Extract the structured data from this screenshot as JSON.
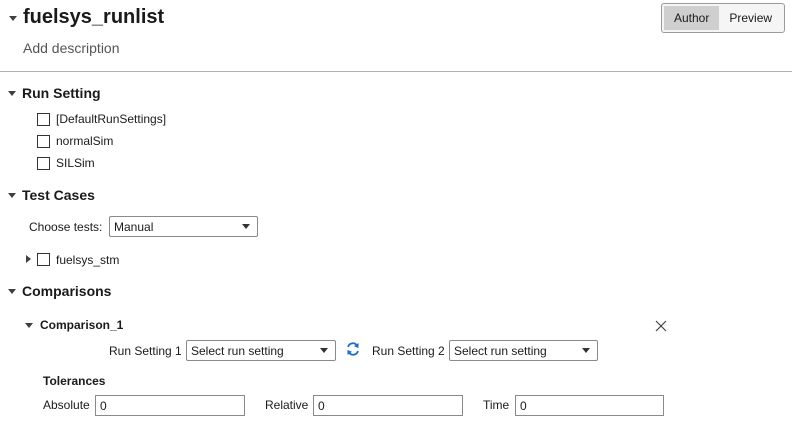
{
  "header": {
    "title": "fuelsys_runlist",
    "description_placeholder": "Add description",
    "modes": [
      {
        "label": "Author",
        "active": true
      },
      {
        "label": "Preview",
        "active": false
      }
    ]
  },
  "run_setting": {
    "title": "Run Setting",
    "items": [
      {
        "label": "[DefaultRunSettings]",
        "checked": false
      },
      {
        "label": "normalSim",
        "checked": false
      },
      {
        "label": "SILSim",
        "checked": false
      }
    ]
  },
  "test_cases": {
    "title": "Test Cases",
    "choose_label": "Choose tests:",
    "choose_value": "Manual",
    "items": [
      {
        "label": "fuelsys_stm",
        "checked": false,
        "expanded": false
      }
    ]
  },
  "comparisons": {
    "title": "Comparisons",
    "items": [
      {
        "name": "Comparison_1",
        "run_setting_1_label": "Run Setting 1",
        "run_setting_1_value": "Select run setting",
        "run_setting_2_label": "Run Setting 2",
        "run_setting_2_value": "Select run setting",
        "tolerances": {
          "title": "Tolerances",
          "absolute_label": "Absolute",
          "absolute_value": "0",
          "relative_label": "Relative",
          "relative_value": "0",
          "time_label": "Time",
          "time_value": "0"
        }
      }
    ]
  },
  "colors": {
    "swap_icon": "#1a6fc4",
    "divider": "#b0b0b0",
    "active_mode": "#cfcfcf"
  },
  "icons": {
    "collapse": "chevron-down-icon",
    "expand": "chevron-right-icon",
    "swap": "swap-icon",
    "close": "close-icon"
  }
}
